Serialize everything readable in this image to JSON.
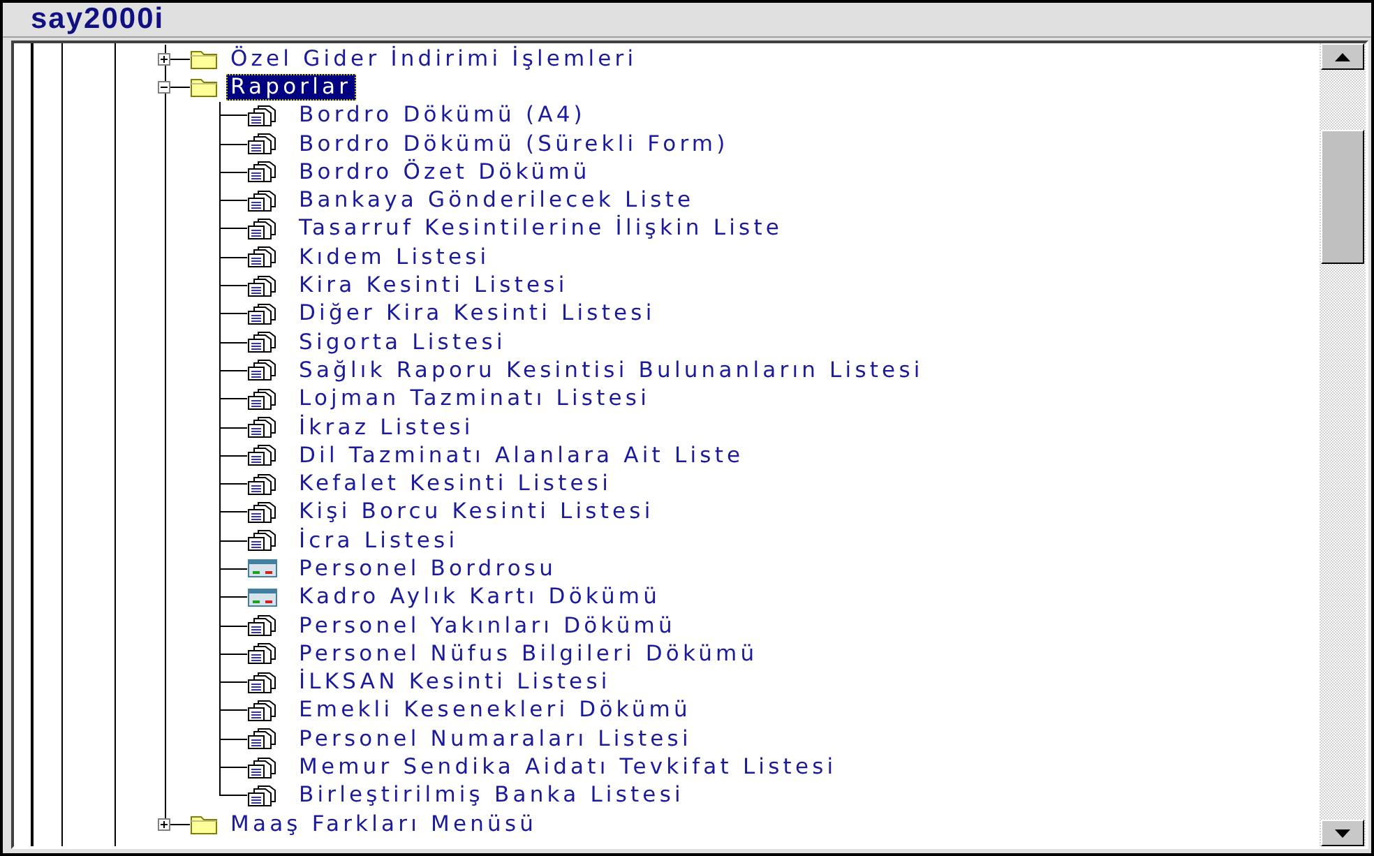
{
  "window": {
    "title": "say2000i"
  },
  "tree": [
    {
      "kind": "folder",
      "label": "Özel Gider İndirimi İşlemleri",
      "expanded": false,
      "selected": false
    },
    {
      "kind": "folder",
      "label": "Raporlar",
      "expanded": true,
      "selected": true,
      "children": [
        {
          "kind": "report",
          "label": "Bordro Dökümü (A4)"
        },
        {
          "kind": "report",
          "label": "Bordro Dökümü (Sürekli Form)"
        },
        {
          "kind": "report",
          "label": "Bordro Özet Dökümü"
        },
        {
          "kind": "report",
          "label": "Bankaya Gönderilecek Liste"
        },
        {
          "kind": "report",
          "label": "Tasarruf Kesintilerine İlişkin Liste"
        },
        {
          "kind": "report",
          "label": "Kıdem Listesi"
        },
        {
          "kind": "report",
          "label": "Kira Kesinti Listesi"
        },
        {
          "kind": "report",
          "label": "Diğer Kira Kesinti Listesi"
        },
        {
          "kind": "report",
          "label": "Sigorta Listesi"
        },
        {
          "kind": "report",
          "label": "Sağlık Raporu Kesintisi Bulunanların Listesi"
        },
        {
          "kind": "report",
          "label": "Lojman Tazminatı Listesi"
        },
        {
          "kind": "report",
          "label": "İkraz Listesi"
        },
        {
          "kind": "report",
          "label": "Dil Tazminatı Alanlara Ait Liste"
        },
        {
          "kind": "report",
          "label": "Kefalet Kesinti Listesi"
        },
        {
          "kind": "report",
          "label": "Kişi Borcu Kesinti Listesi"
        },
        {
          "kind": "report",
          "label": "İcra Listesi"
        },
        {
          "kind": "form",
          "label": "Personel Bordrosu"
        },
        {
          "kind": "form",
          "label": "Kadro Aylık Kartı Dökümü"
        },
        {
          "kind": "report",
          "label": "Personel Yakınları Dökümü"
        },
        {
          "kind": "report",
          "label": "Personel Nüfus Bilgileri Dökümü"
        },
        {
          "kind": "report",
          "label": "İLKSAN Kesinti Listesi"
        },
        {
          "kind": "report",
          "label": "Emekli Kesenekleri Dökümü"
        },
        {
          "kind": "report",
          "label": "Personel Numaraları Listesi"
        },
        {
          "kind": "report",
          "label": "Memur Sendika Aidatı Tevkifat Listesi"
        },
        {
          "kind": "report",
          "label": "Birleştirilmiş Banka Listesi"
        }
      ]
    },
    {
      "kind": "folder",
      "label": "Maaş Farkları Menüsü",
      "expanded": false,
      "selected": false
    }
  ]
}
